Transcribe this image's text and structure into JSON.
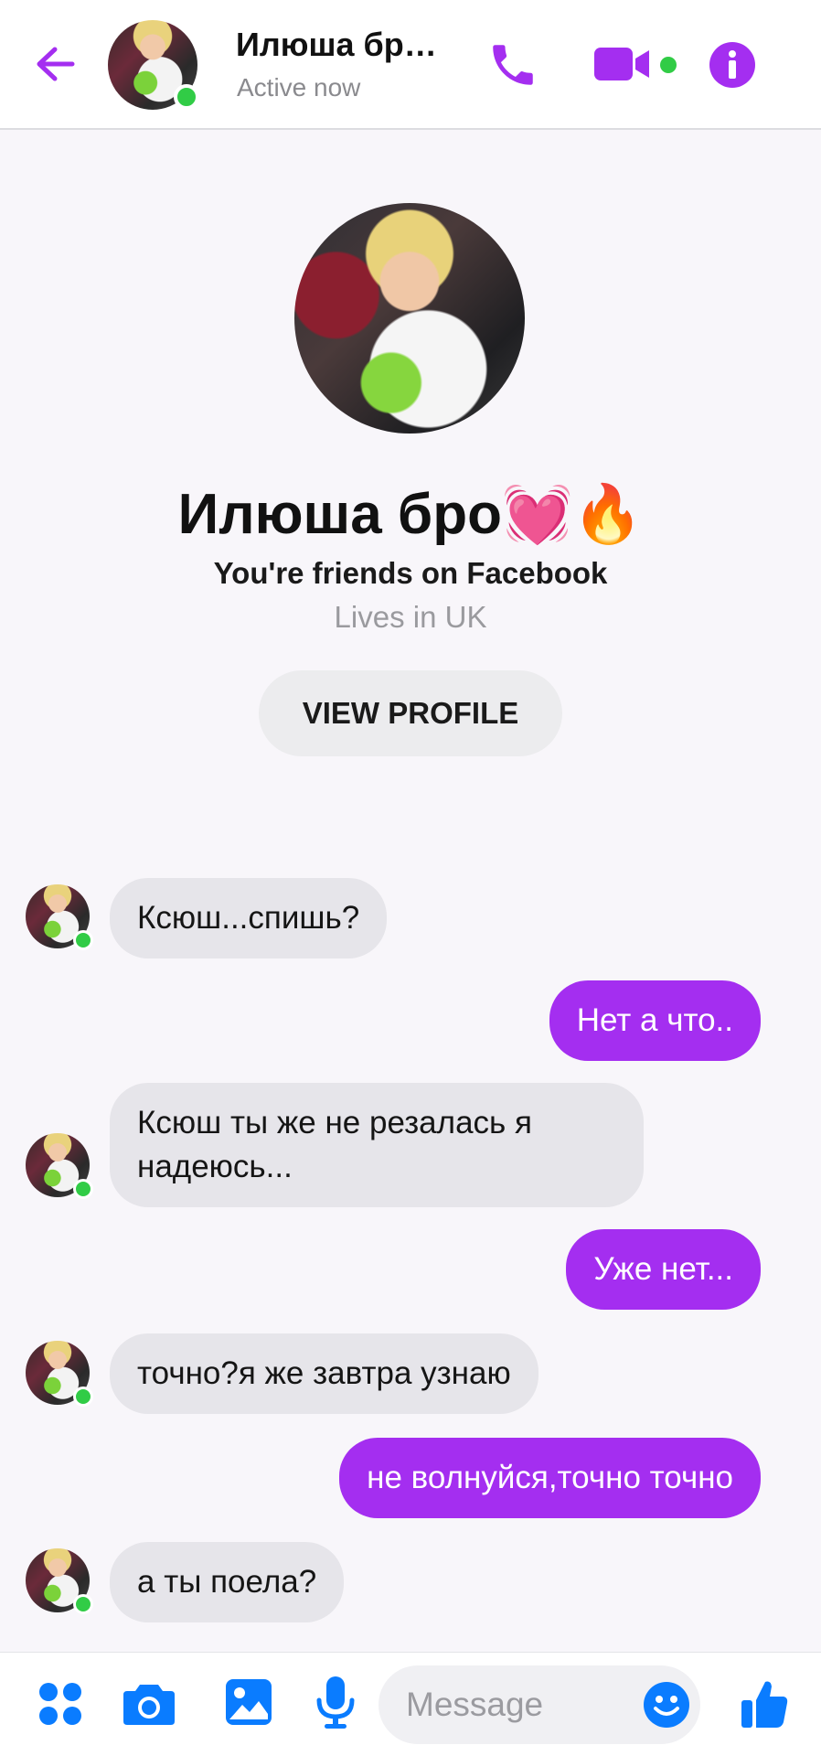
{
  "header": {
    "title": "Илюша бро💓🔥",
    "status": "Active now"
  },
  "profile": {
    "name": "Илюша бро💓🔥",
    "friends_text": "You're friends on Facebook",
    "location": "Lives in UK",
    "view_profile_label": "VIEW PROFILE"
  },
  "messages": [
    {
      "from": "them",
      "text": "Ксюш...спишь?"
    },
    {
      "from": "me",
      "text": "Нет а что.."
    },
    {
      "from": "them",
      "text": "Ксюш ты же не резалась я надеюсь..."
    },
    {
      "from": "me",
      "text": "Уже нет..."
    },
    {
      "from": "them",
      "text": "точно?я же завтра узнаю"
    },
    {
      "from": "me",
      "text": "не волнуйся,точно точно"
    },
    {
      "from": "them",
      "text": "а ты поела?"
    }
  ],
  "composer": {
    "placeholder": "Message"
  },
  "icons": {
    "back": "arrow-left-icon",
    "call": "phone-icon",
    "video": "video-camera-icon",
    "info": "info-icon",
    "apps": "four-dots-icon",
    "camera": "camera-icon",
    "gallery": "image-icon",
    "mic": "microphone-icon",
    "emoji": "smiley-icon",
    "like": "thumbs-up-icon"
  },
  "colors": {
    "accent": "#a42ef0",
    "blue": "#0a7cff",
    "online": "#31cc46",
    "incoming_bubble": "#e6e5ea",
    "outgoing_bubble": "#a42ef0"
  }
}
